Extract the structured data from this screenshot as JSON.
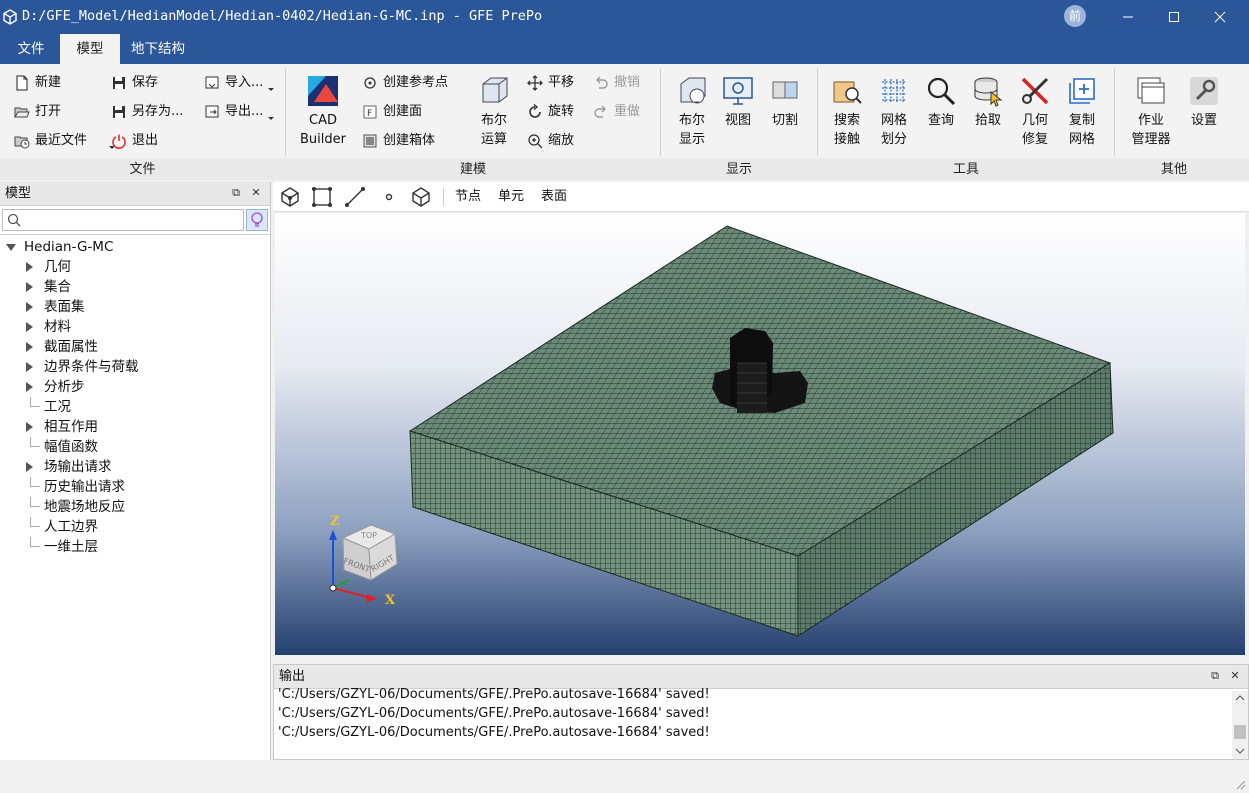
{
  "window": {
    "title": "D:/GFE_Model/HedianModel/Hedian-0402/Hedian-G-MC.inp - GFE PrePo",
    "user_initial": "前"
  },
  "tabs": [
    {
      "label": "文件",
      "active": false
    },
    {
      "label": "模型",
      "active": true
    },
    {
      "label": "地下结构",
      "active": false
    }
  ],
  "ribbon": {
    "file": {
      "new": "新建",
      "open": "打开",
      "recent": "最近文件",
      "save": "保存",
      "save_as": "另存为...",
      "exit": "退出",
      "import": "导入...",
      "export": "导出...",
      "group": "文件"
    },
    "modeling": {
      "cad_line1": "CAD",
      "cad_line2": "Builder",
      "ref_point": "创建参考点",
      "face": "创建面",
      "box": "创建箱体",
      "bool_line1": "布尔",
      "bool_line2": "运算",
      "pan": "平移",
      "rotate": "旋转",
      "zoom": "缩放",
      "undo": "撤销",
      "redo": "重做",
      "group": "建模"
    },
    "display": {
      "bool_line1": "布尔",
      "bool_line2": "显示",
      "view": "视图",
      "cut": "切割",
      "group": "显示"
    },
    "tools": {
      "search_line1": "搜索",
      "search_line2": "接触",
      "mesh_line1": "网格",
      "mesh_line2": "划分",
      "query": "查询",
      "pick": "拾取",
      "repair_line1": "几何",
      "repair_line2": "修复",
      "copy_line1": "复制",
      "copy_line2": "网格",
      "group": "工具"
    },
    "other": {
      "job_line1": "作业",
      "job_line2": "管理器",
      "settings": "设置",
      "group": "其他"
    }
  },
  "model_panel": {
    "title": "模型",
    "search_placeholder": "",
    "root": "Hedian-G-MC",
    "items": [
      {
        "label": "几何",
        "expandable": true
      },
      {
        "label": "集合",
        "expandable": true
      },
      {
        "label": "表面集",
        "expandable": true
      },
      {
        "label": "材料",
        "expandable": true
      },
      {
        "label": "截面属性",
        "expandable": true
      },
      {
        "label": "边界条件与荷载",
        "expandable": true
      },
      {
        "label": "分析步",
        "expandable": true
      },
      {
        "label": "工况",
        "expandable": false
      },
      {
        "label": "相互作用",
        "expandable": true
      },
      {
        "label": "幅值函数",
        "expandable": false
      },
      {
        "label": "场输出请求",
        "expandable": true
      },
      {
        "label": "历史输出请求",
        "expandable": false
      },
      {
        "label": "地震场地反应",
        "expandable": false
      },
      {
        "label": "人工边界",
        "expandable": false
      },
      {
        "label": "一维土层",
        "expandable": false
      }
    ]
  },
  "viewport_toolbar": {
    "node": "节点",
    "element": "单元",
    "surface": "表面"
  },
  "view_cube": {
    "top": "TOP",
    "front": "FRONT",
    "right": "RIGHT",
    "axis_z": "Z",
    "axis_x": "X"
  },
  "output": {
    "title": "输出",
    "lines": [
      "'C:/Users/GZYL-06/Documents/GFE/.PrePo.autosave-16684' saved!",
      "'C:/Users/GZYL-06/Documents/GFE/.PrePo.autosave-16684' saved!",
      "'C:/Users/GZYL-06/Documents/GFE/.PrePo.autosave-16684' saved!"
    ]
  },
  "colors": {
    "title_bar": "#2b579a",
    "mesh_fill": "#6b8a7a",
    "mesh_line": "#1a2a22"
  }
}
